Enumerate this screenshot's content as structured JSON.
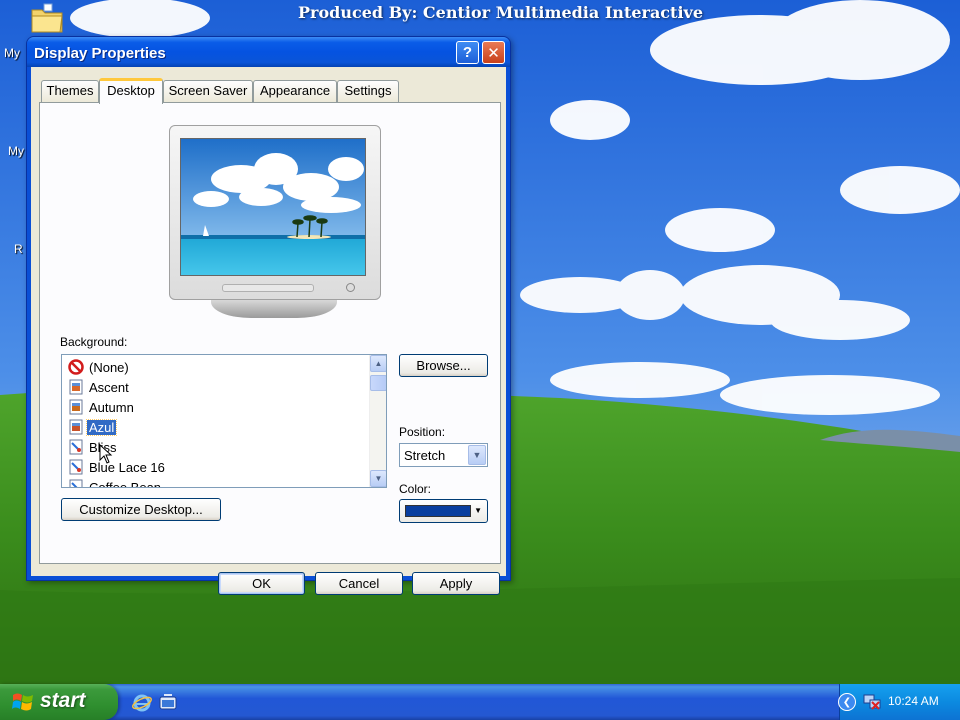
{
  "overlay": {
    "caption": "Produced By: Centior Multimedia Interactive"
  },
  "desktop": {
    "icon_labels": [
      "My",
      "My",
      "R"
    ]
  },
  "window": {
    "title": "Display Properties",
    "help_glyph": "?",
    "close_glyph": "✕",
    "tabs": [
      {
        "label": "Themes",
        "active": false
      },
      {
        "label": "Desktop",
        "active": true
      },
      {
        "label": "Screen Saver",
        "active": false
      },
      {
        "label": "Appearance",
        "active": false
      },
      {
        "label": "Settings",
        "active": false
      }
    ],
    "background_label": "Background:",
    "backgrounds": [
      {
        "label": "(None)",
        "icon": "no-symbol-icon",
        "selected": false
      },
      {
        "label": "Ascent",
        "icon": "image-file-icon",
        "selected": false
      },
      {
        "label": "Autumn",
        "icon": "image-file-icon",
        "selected": false
      },
      {
        "label": "Azul",
        "icon": "image-file-icon",
        "selected": true
      },
      {
        "label": "Bliss",
        "icon": "paint-file-icon",
        "selected": false
      },
      {
        "label": "Blue Lace 16",
        "icon": "paint-file-icon",
        "selected": false
      },
      {
        "label": "Coffee Bean",
        "icon": "paint-file-icon",
        "selected": false
      }
    ],
    "browse_label": "Browse...",
    "position_label": "Position:",
    "position_value": "Stretch",
    "color_label": "Color:",
    "color_value": "#0a3f9f",
    "customize_label": "Customize Desktop...",
    "ok_label": "OK",
    "cancel_label": "Cancel",
    "apply_label": "Apply"
  },
  "taskbar": {
    "start_label": "start",
    "clock": "10:24 AM"
  },
  "colors": {
    "titlebar_blue": "#0553e1",
    "selection_blue": "#316ac5",
    "start_green": "#3c9a3c",
    "tray_blue": "#0c8ae0"
  }
}
